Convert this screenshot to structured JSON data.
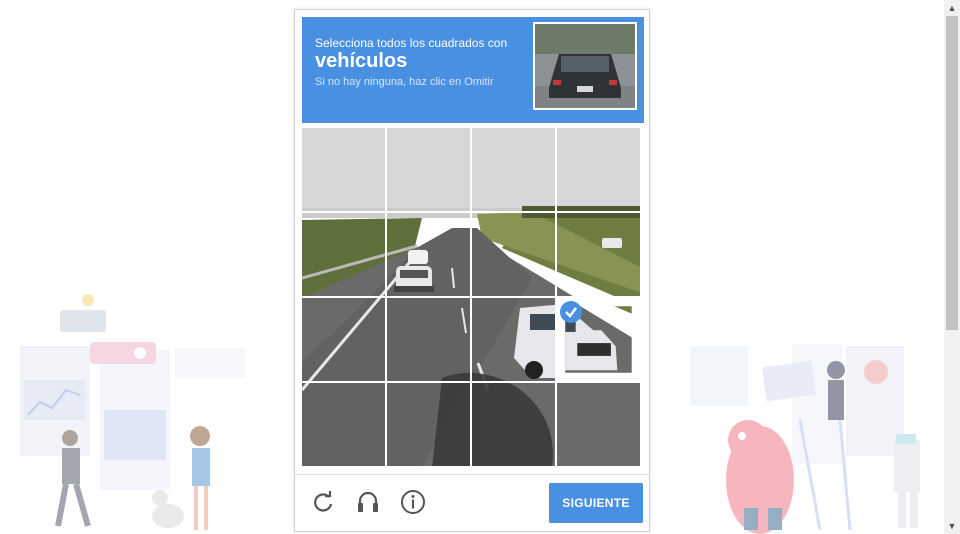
{
  "captcha": {
    "instruction_small": "Selecciona todos los cuadrados con",
    "instruction_object": "vehículos",
    "instruction_hint": "Si no hay ninguna, haz clic en Omitir",
    "header_color": "#4a90e2",
    "selected_tiles": [
      7
    ],
    "verify_label": "SIGUIENTE",
    "footer_icons": [
      "reload-icon",
      "audio-icon",
      "info-icon"
    ]
  }
}
